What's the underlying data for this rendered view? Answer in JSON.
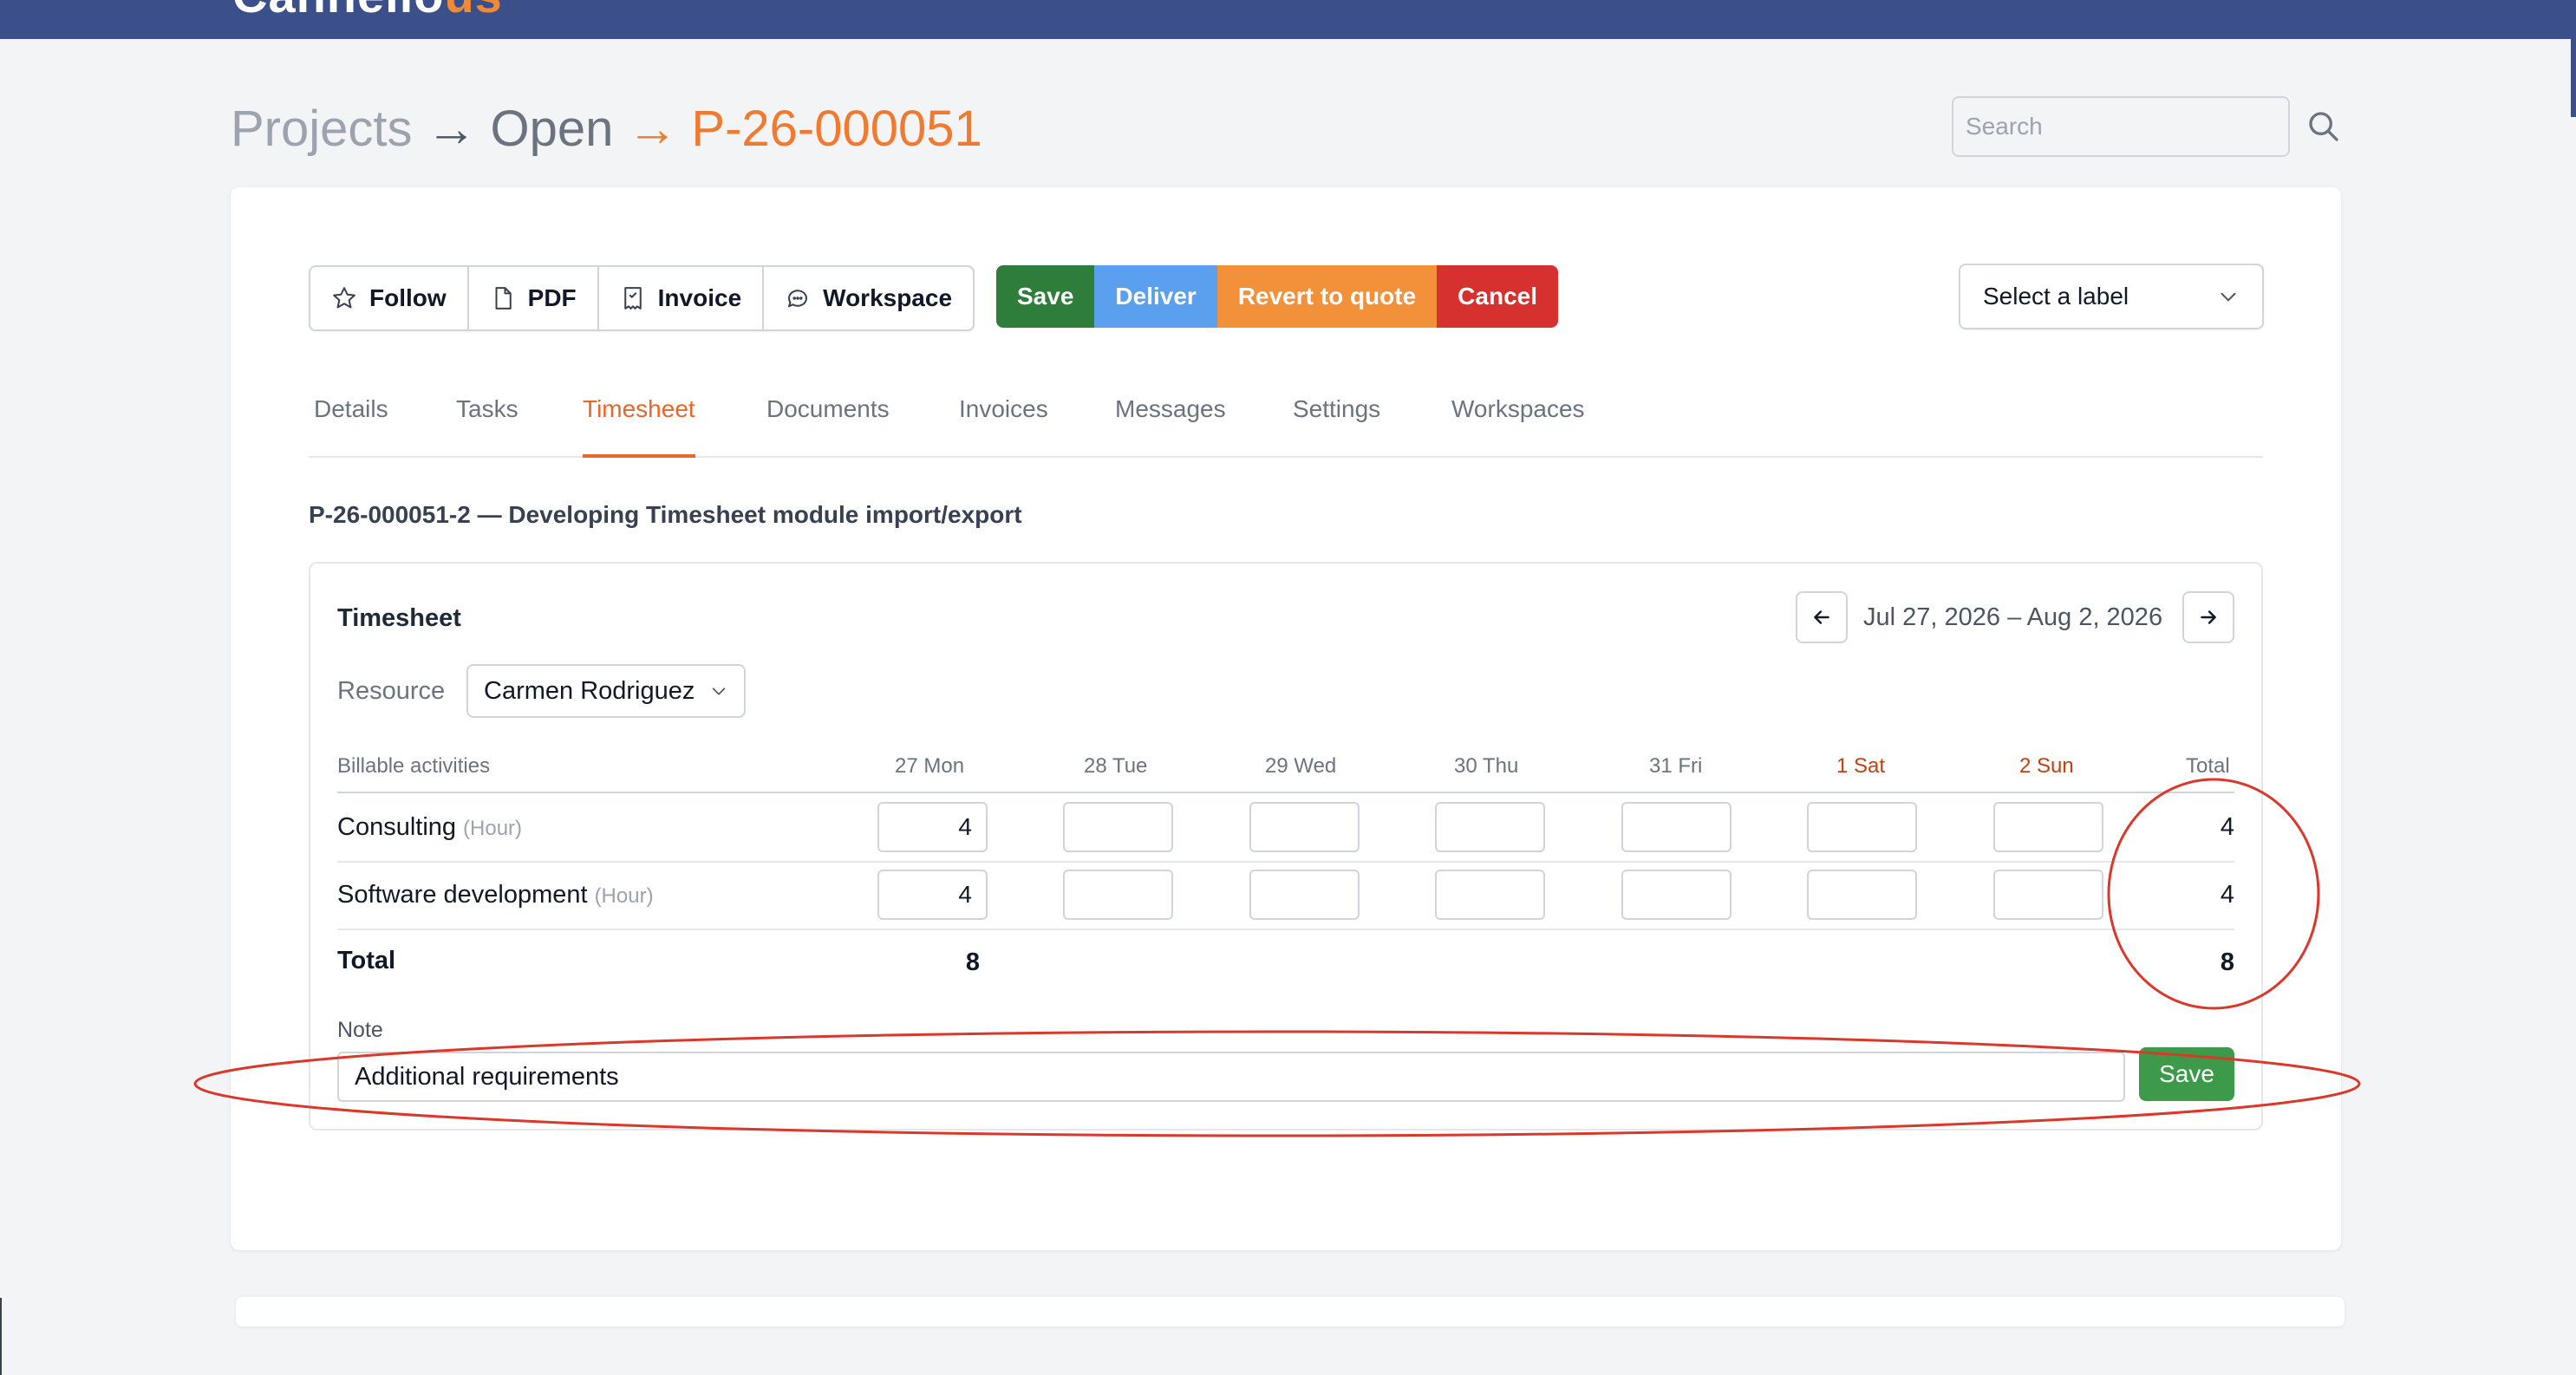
{
  "app": {
    "logo_main": "Cannello",
    "logo_accent": "us"
  },
  "breadcrumb": {
    "projects": "Projects",
    "open": "Open",
    "current": "P-26-000051",
    "arrow": "→"
  },
  "search": {
    "placeholder": "Search"
  },
  "toolbar": {
    "follow": "Follow",
    "pdf": "PDF",
    "invoice": "Invoice",
    "workspace": "Workspace",
    "save": "Save",
    "deliver": "Deliver",
    "revert": "Revert to quote",
    "cancel": "Cancel",
    "label_select": "Select a label"
  },
  "tabs": [
    {
      "label": "Details"
    },
    {
      "label": "Tasks"
    },
    {
      "label": "Timesheet",
      "active": true
    },
    {
      "label": "Documents"
    },
    {
      "label": "Invoices"
    },
    {
      "label": "Messages"
    },
    {
      "label": "Settings"
    },
    {
      "label": "Workspaces"
    }
  ],
  "task_title": "P-26-000051-2 — Developing Timesheet module import/export",
  "timesheet": {
    "heading": "Timesheet",
    "date_range": "Jul 27, 2026 – Aug 2, 2026",
    "resource_label": "Resource",
    "resource_value": "Carmen Rodriguez",
    "columns": {
      "activities": "Billable activities",
      "days": [
        "27 Mon",
        "28 Tue",
        "29 Wed",
        "30 Thu",
        "31 Fri",
        "1 Sat",
        "2 Sun"
      ],
      "total": "Total"
    },
    "rows": [
      {
        "label": "Consulting",
        "unit": "(Hour)",
        "values": [
          "4",
          "",
          "",
          "",
          "",
          "",
          ""
        ],
        "total": "4"
      },
      {
        "label": "Software development",
        "unit": "(Hour)",
        "values": [
          "4",
          "",
          "",
          "",
          "",
          "",
          ""
        ],
        "total": "4"
      }
    ],
    "totals": {
      "label": "Total",
      "first_day": "8",
      "grand_total": "8"
    },
    "note_label": "Note",
    "note_value": "Additional requirements",
    "note_save": "Save"
  },
  "colors": {
    "topbar": "#3b4f8a",
    "accent": "#e8672a",
    "save": "#2f7d3a",
    "deliver": "#5aa0ee",
    "revert": "#f2913a",
    "cancel": "#d7312f",
    "annotation": "#d9382b"
  }
}
